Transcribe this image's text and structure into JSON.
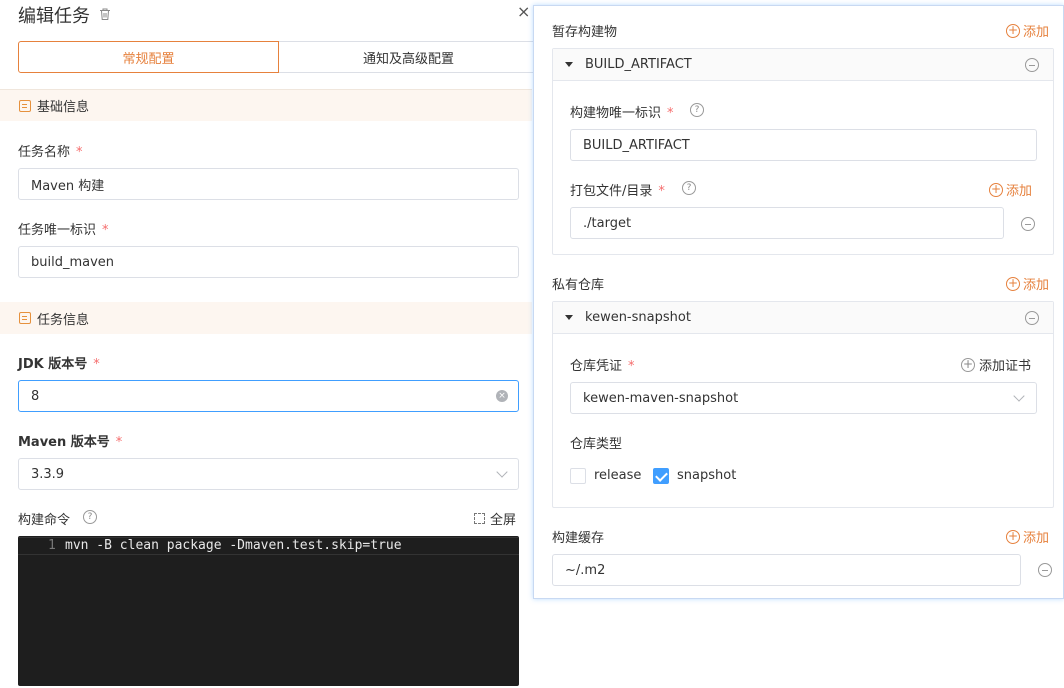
{
  "header": {
    "title": "编辑任务",
    "close_label": "×"
  },
  "tabs": [
    {
      "label": "常规配置",
      "active": true
    },
    {
      "label": "通知及高级配置",
      "active": false
    }
  ],
  "sections": {
    "basic": "基础信息",
    "task": "任务信息"
  },
  "fields": {
    "task_name": {
      "label": "任务名称",
      "value": "Maven 构建"
    },
    "task_id": {
      "label": "任务唯一标识",
      "value": "build_maven"
    },
    "jdk": {
      "label": "JDK 版本号",
      "value": "8"
    },
    "maven": {
      "label": "Maven 版本号",
      "value": "3.3.9"
    },
    "command": {
      "label": "构建命令",
      "fullscreen_label": "全屏",
      "line_number": "1",
      "code": "mvn -B clean package -Dmaven.test.skip=true"
    }
  },
  "right": {
    "artifacts": {
      "title": "暂存构建物",
      "add_label": "添加",
      "card_title": "BUILD_ARTIFACT",
      "id_label": "构建物唯一标识",
      "id_value": "BUILD_ARTIFACT",
      "path_label": "打包文件/目录",
      "path_add_label": "添加",
      "path_value": "./target"
    },
    "repo": {
      "title": "私有仓库",
      "add_label": "添加",
      "card_title": "kewen-snapshot",
      "cred_label": "仓库凭证",
      "add_cert_label": "添加证书",
      "cred_value": "kewen-maven-snapshot",
      "type_label": "仓库类型",
      "release_label": "release",
      "release_checked": false,
      "snapshot_label": "snapshot",
      "snapshot_checked": true
    },
    "cache": {
      "title": "构建缓存",
      "add_label": "添加",
      "value": "~/.m2"
    }
  },
  "colors": {
    "accent": "#e6813d",
    "focus": "#409eff",
    "required": "#f56c6c",
    "editor_bg": "#1e1e1e"
  }
}
